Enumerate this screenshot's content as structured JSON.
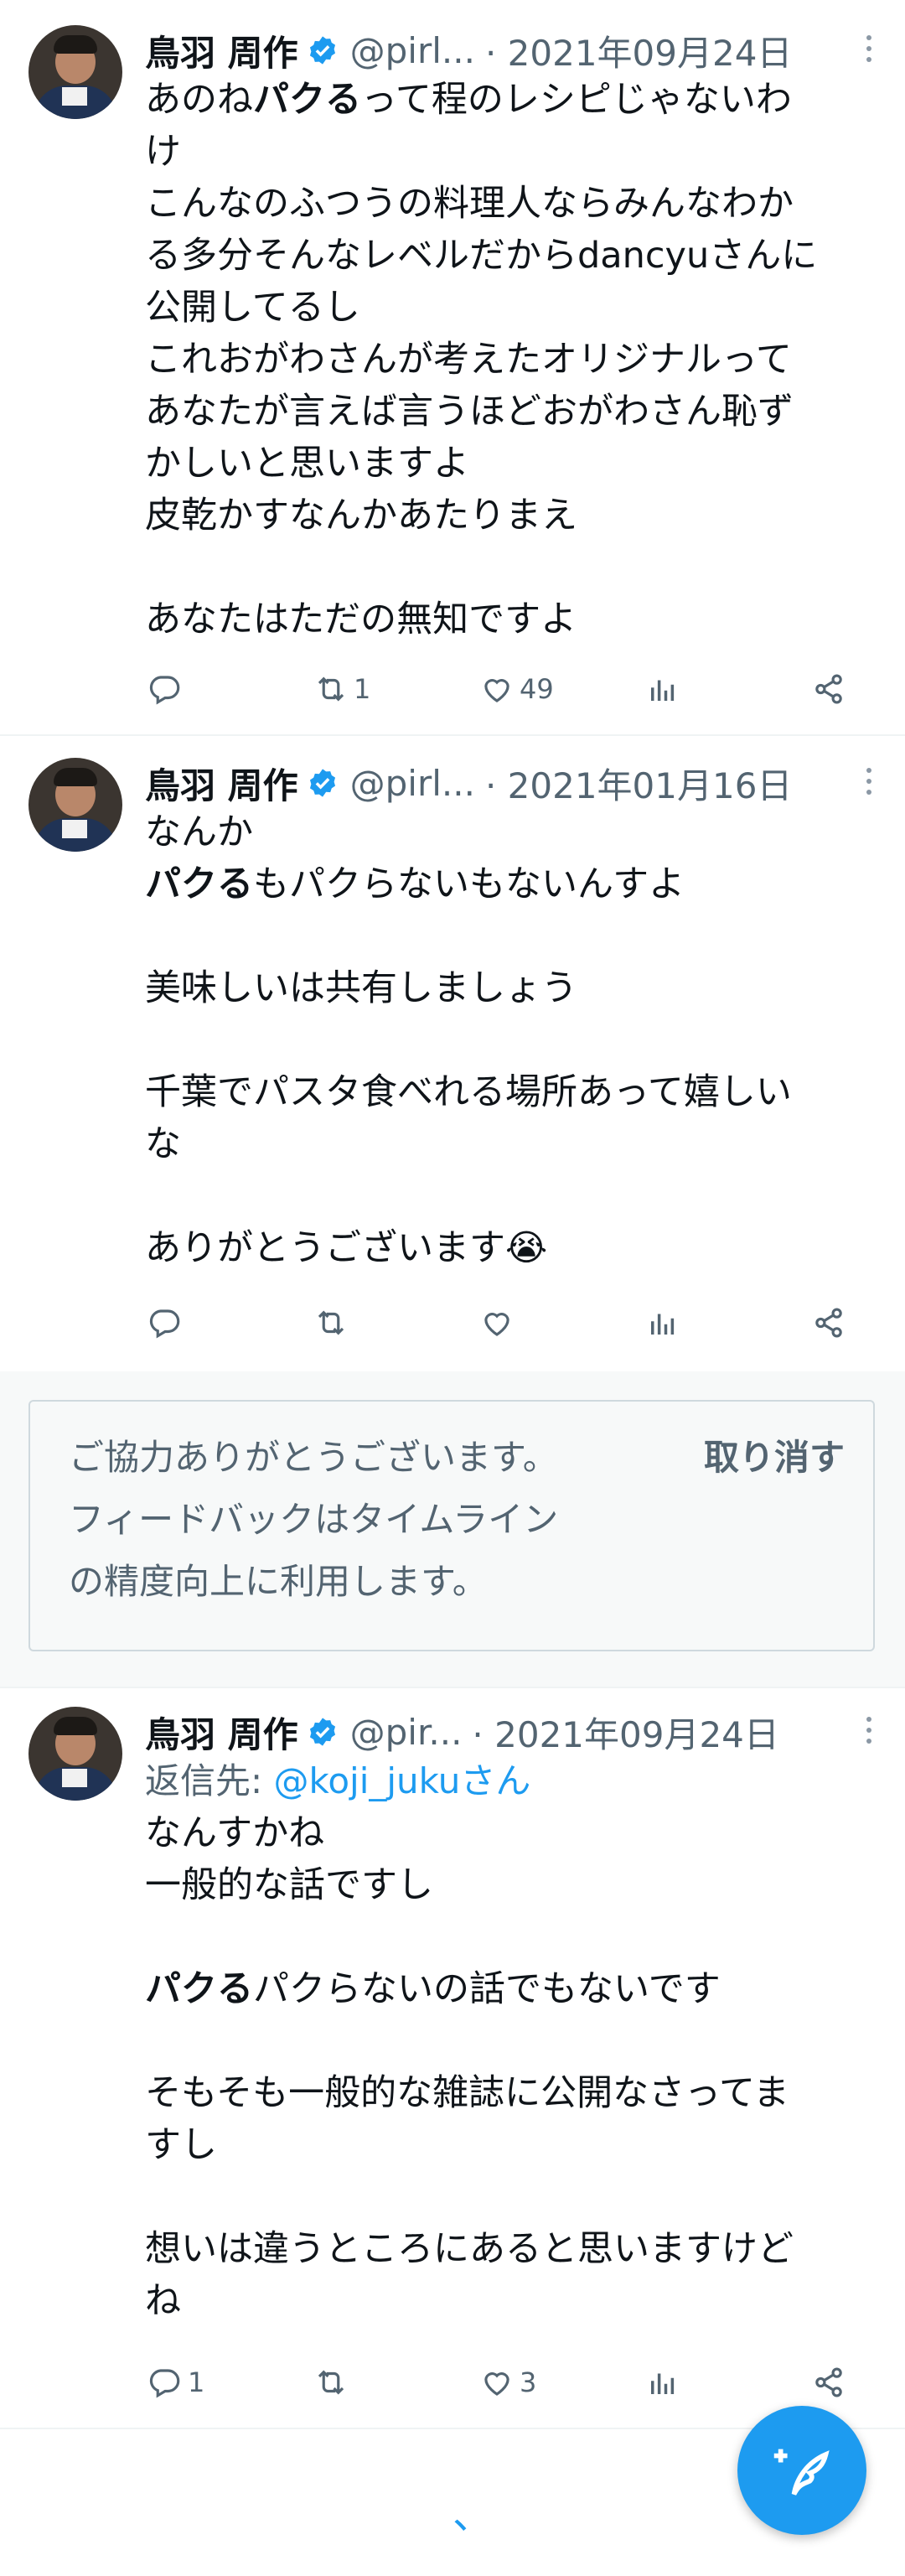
{
  "tweets": [
    {
      "name": "鳥羽 周作",
      "handle": "@pirl...",
      "date": "· 2021年09月24日",
      "lines": [
        "あのね",
        "パクる",
        "って程のレシピじゃないわ\nけ\nこんなのふつうの料理人ならみんなわか\nる多分そんなレベルだからdancyuさんに\n公開してるし\nこれおがわさんが考えたオリジナルって\nあなたが言えば言うほどおがわさん恥ず\nかしいと思いますよ\n皮乾かすなんかあたりまえ\n\nあなたはただの無知ですよ"
      ],
      "retweets": "1",
      "likes": "49"
    },
    {
      "name": "鳥羽 周作",
      "handle": "@pirl...",
      "date": "· 2021年01月16日",
      "lines": [
        "なんか\n",
        "パクる",
        "もパクらないもないんすよ\n\n美味しいは共有しましょう\n\n千葉でパスタ食べれる場所あって嬉しい\nな\n\nありがとうございます😭"
      ],
      "retweets": "",
      "likes": ""
    },
    {
      "name": "鳥羽 周作",
      "handle": "@pir...",
      "date": "· 2021年09月24日",
      "reply_prefix": "返信先: ",
      "reply_to": "@koji_jukuさん",
      "lines": [
        "なんすかね\n一般的な話ですし\n\n",
        "パクる",
        "パクらないの話でもないです\n\nそもそも一般的な雑誌に公開なさってま\nすし\n\n想いは違うところにあると思いますけど\nね"
      ],
      "replies": "1",
      "likes": "3"
    }
  ],
  "notice": {
    "text": "ご協力ありがとうございます。\nフィードバックはタイムライン\nの精度向上に利用します。",
    "undo": "取り消す"
  },
  "bottom_mark": "、",
  "colors": {
    "accent": "#1d9bf0",
    "muted": "#536471",
    "text": "#0f1419"
  },
  "icons": [
    "reply-icon",
    "retweet-icon",
    "like-icon",
    "analytics-icon",
    "share-icon",
    "verified-icon",
    "more-icon",
    "compose-icon"
  ]
}
